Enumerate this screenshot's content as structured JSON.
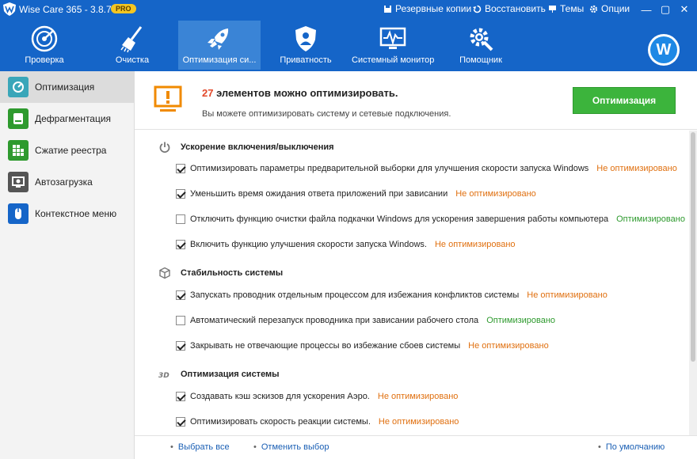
{
  "app": {
    "title": "Wise Care 365 - 3.8.7",
    "badge": "PRO"
  },
  "titlebar": {
    "backup": "Резервные копии",
    "restore": "Восстановить",
    "themes": "Темы",
    "options": "Опции"
  },
  "nav": [
    {
      "label": "Проверка",
      "icon": "radar-icon"
    },
    {
      "label": "Очистка",
      "icon": "broom-icon"
    },
    {
      "label": "Оптимизация си...",
      "icon": "rocket-icon"
    },
    {
      "label": "Приватность",
      "icon": "shield-icon"
    },
    {
      "label": "Системный монитор",
      "icon": "monitor-icon"
    },
    {
      "label": "Помощник",
      "icon": "gear-tools-icon"
    }
  ],
  "user": {
    "initial": "W"
  },
  "sidebar": [
    {
      "label": "Оптимизация",
      "color": "#3aa6b9"
    },
    {
      "label": "Дефрагментация",
      "color": "#2e9a2e"
    },
    {
      "label": "Сжатие реестра",
      "color": "#2e9a2e"
    },
    {
      "label": "Автозагрузка",
      "color": "#555555"
    },
    {
      "label": "Контекстное меню",
      "color": "#1565c8"
    }
  ],
  "header": {
    "count": "27",
    "title_rest": " элементов можно оптимизировать.",
    "subtitle": "Вы можете оптимизировать систему и сетевые подключения.",
    "button": "Оптимизация"
  },
  "groups": [
    {
      "title": "Ускорение включения/выключения",
      "items": [
        {
          "text": "Оптимизировать параметры предварительной выборки для улучшения скорости запуска Windows",
          "checked": true,
          "status": "Не оптимизировано"
        },
        {
          "text": "Уменьшить время ожидания ответа приложений при зависании",
          "checked": true,
          "status": "Не оптимизировано"
        },
        {
          "text": "Отключить функцию очистки файла подкачки Windows для ускорения завершения работы компьютера",
          "checked": false,
          "status": "Оптимизировано"
        },
        {
          "text": "Включить функцию улучшения скорости запуска Windows.",
          "checked": true,
          "status": "Не оптимизировано"
        }
      ]
    },
    {
      "title": "Стабильность системы",
      "items": [
        {
          "text": "Запускать проводник отдельным процессом для избежания конфликтов системы",
          "checked": true,
          "status": "Не оптимизировано"
        },
        {
          "text": "Автоматический перезапуск проводника при зависании рабочего стола",
          "checked": false,
          "status": "Оптимизировано"
        },
        {
          "text": "Закрывать не отвечающие процессы во избежание сбоев системы",
          "checked": true,
          "status": "Не оптимизировано"
        }
      ]
    },
    {
      "title": "Оптимизация системы",
      "items": [
        {
          "text": "Создавать кэш эскизов для ускорения Аэро.",
          "checked": true,
          "status": "Не оптимизировано"
        },
        {
          "text": "Оптимизировать скорость реакции системы.",
          "checked": true,
          "status": "Не оптимизировано"
        }
      ]
    }
  ],
  "footer": {
    "select_all": "Выбрать все",
    "deselect": "Отменить выбор",
    "default": "По умолчанию"
  }
}
